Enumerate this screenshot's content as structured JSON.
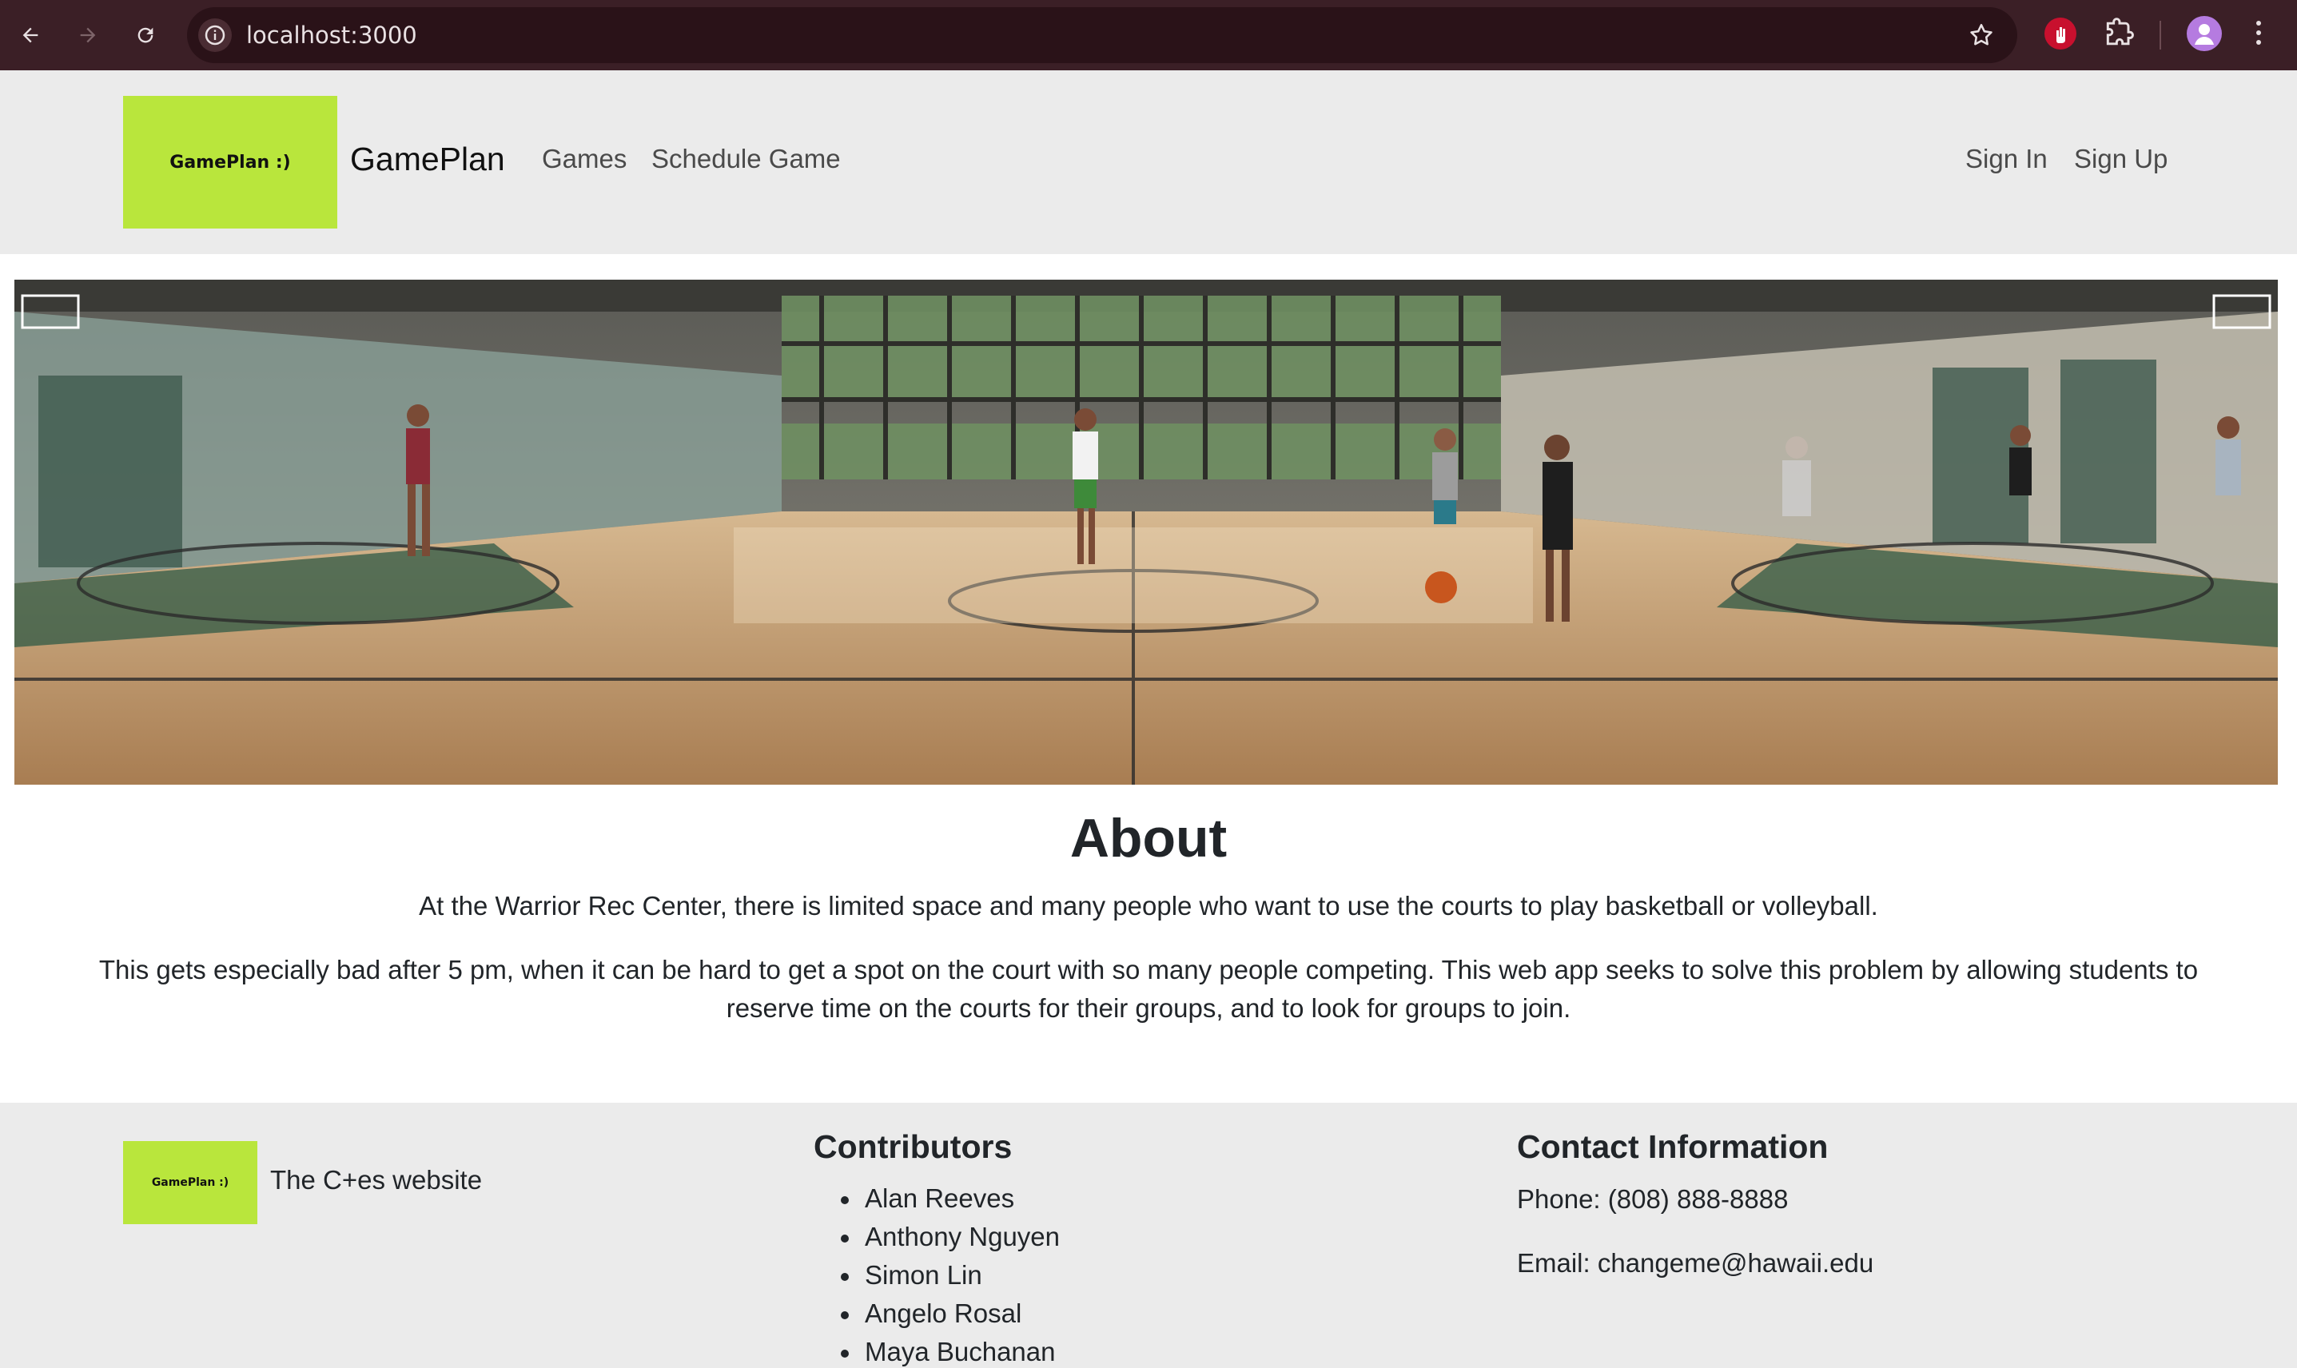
{
  "browser": {
    "url": "localhost:3000"
  },
  "navbar": {
    "logo_text": "GamePlan :)",
    "brand": "GamePlan",
    "links": [
      "Games",
      "Schedule Game"
    ],
    "auth_links": [
      "Sign In",
      "Sign Up"
    ]
  },
  "about": {
    "title": "About",
    "paragraph_1": "At the Warrior Rec Center, there is limited space and many people who want to use the courts to play basketball or volleyball.",
    "paragraph_2_line_1": "This gets especially bad after 5 pm, when it can be hard to get a spot on the court with so many people competing. This web app seeks to solve this problem by allowing students to",
    "paragraph_2_line_2": "reserve time on the courts for their groups, and to look for groups to join."
  },
  "footer": {
    "logo_text": "GamePlan :)",
    "tagline": "The C+es website",
    "contributors_heading": "Contributors",
    "contributors": [
      "Alan Reeves",
      "Anthony Nguyen",
      "Simon Lin",
      "Angelo Rosal",
      "Maya Buchanan"
    ],
    "contact_heading": "Contact Information",
    "phone": "Phone: (808) 888-8888",
    "email": "Email: changeme@hawaii.edu"
  },
  "colors": {
    "logo_green": "#b9e63c",
    "nav_bg": "#ebebeb",
    "chrome_bg": "#3b1f26"
  }
}
